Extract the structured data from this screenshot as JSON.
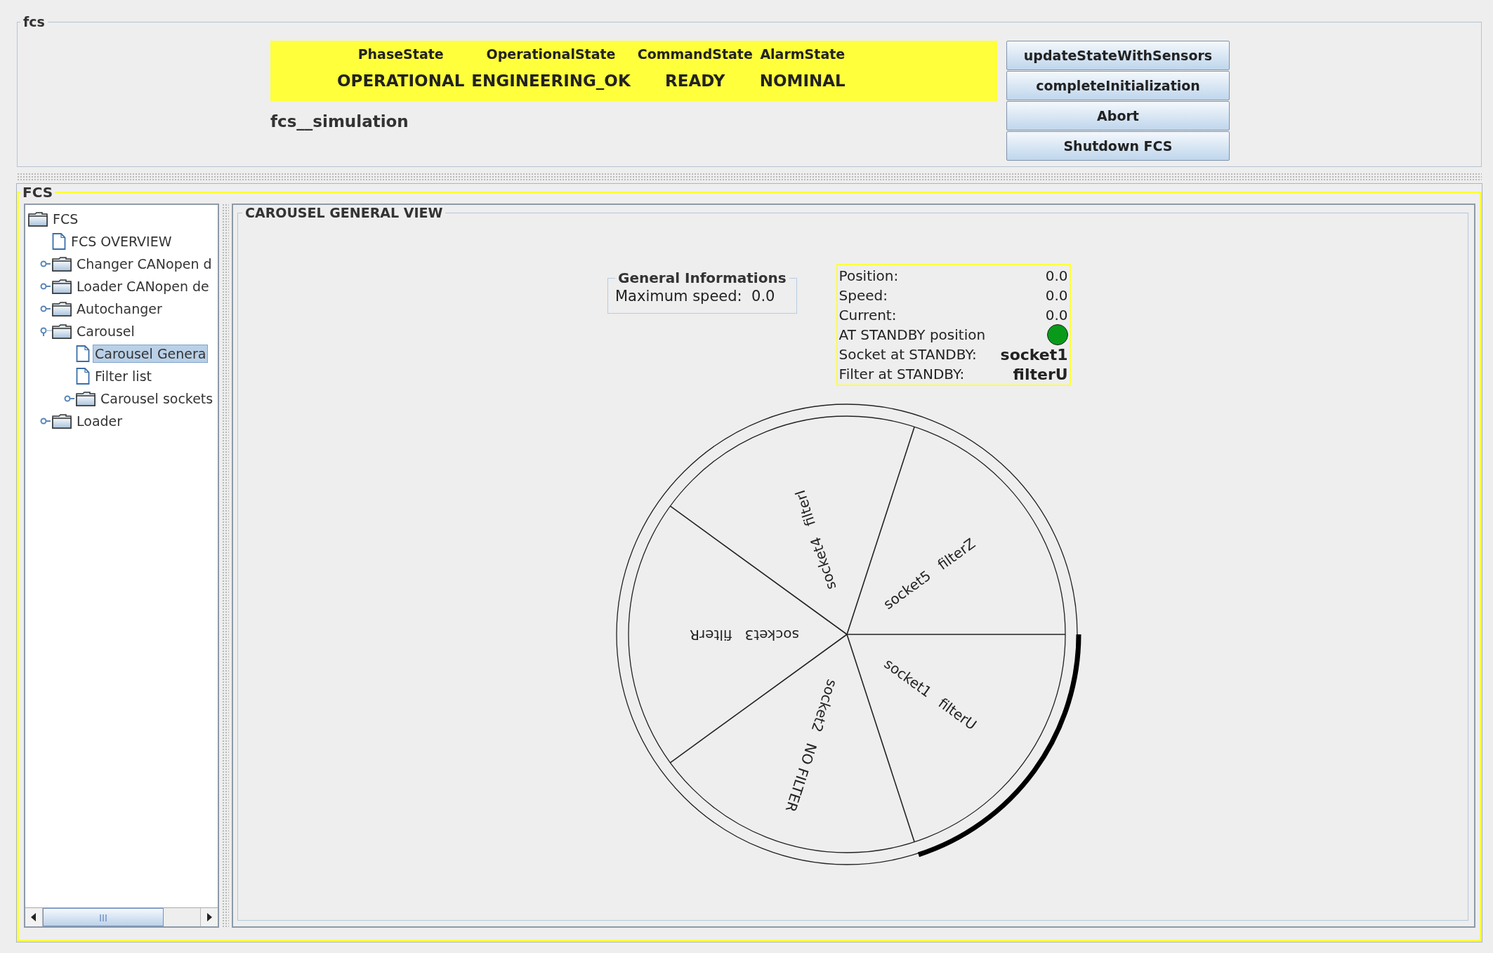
{
  "top_panel": {
    "title": "fcs",
    "states": [
      {
        "label": "PhaseState",
        "value": "OPERATIONAL"
      },
      {
        "label": "OperationalState",
        "value": "ENGINEERING_OK"
      },
      {
        "label": "CommandState",
        "value": "READY"
      },
      {
        "label": "AlarmState",
        "value": "NOMINAL"
      }
    ],
    "subsystem": "fcs__simulation",
    "buttons": [
      "updateStateWithSensors",
      "completeInitialization",
      "Abort",
      "Shutdown FCS"
    ]
  },
  "main_panel": {
    "title": "FCS",
    "tree": [
      {
        "label": "FCS",
        "kind": "folder",
        "selected": false,
        "children": [
          {
            "label": "FCS OVERVIEW",
            "kind": "page",
            "selected": false
          },
          {
            "label": "Changer CANopen d",
            "kind": "folder",
            "expanded": false,
            "selected": false
          },
          {
            "label": "Loader CANopen de",
            "kind": "folder",
            "expanded": false,
            "selected": false
          },
          {
            "label": "Autochanger",
            "kind": "folder",
            "expanded": false,
            "selected": false
          },
          {
            "label": "Carousel",
            "kind": "folder",
            "expanded": true,
            "selected": false,
            "children": [
              {
                "label": "Carousel Genera",
                "kind": "page",
                "selected": true
              },
              {
                "label": "Filter list",
                "kind": "page",
                "selected": false
              },
              {
                "label": "Carousel sockets",
                "kind": "folder",
                "expanded": false,
                "selected": false
              }
            ]
          },
          {
            "label": "Loader",
            "kind": "folder",
            "expanded": false,
            "selected": false
          }
        ]
      }
    ],
    "view": {
      "title": "CAROUSEL GENERAL VIEW",
      "general": {
        "title": "General Informations",
        "label": "Maximum speed:",
        "value": "0.0"
      },
      "status": [
        {
          "kind": "number",
          "label": "Position:",
          "value": "0.0"
        },
        {
          "kind": "number",
          "label": "Speed:",
          "value": "0.0"
        },
        {
          "kind": "number",
          "label": "Current:",
          "value": "0.0"
        },
        {
          "kind": "indicator",
          "label": "AT STANDBY position",
          "color": "#0a9a1a"
        },
        {
          "kind": "name",
          "label": "Socket at STANDBY:",
          "value": "socket1"
        },
        {
          "kind": "name",
          "label": "Filter at STANDBY:",
          "value": "filterU"
        }
      ],
      "sockets": [
        {
          "socket": "socket1",
          "filter": "filterU",
          "at_standby": true
        },
        {
          "socket": "socket2",
          "filter": "NO FILTER",
          "at_standby": false
        },
        {
          "socket": "socket3",
          "filter": "filterR",
          "at_standby": false
        },
        {
          "socket": "socket4",
          "filter": "filterI",
          "at_standby": false
        },
        {
          "socket": "socket5",
          "filter": "filterZ",
          "at_standby": false
        }
      ]
    }
  }
}
